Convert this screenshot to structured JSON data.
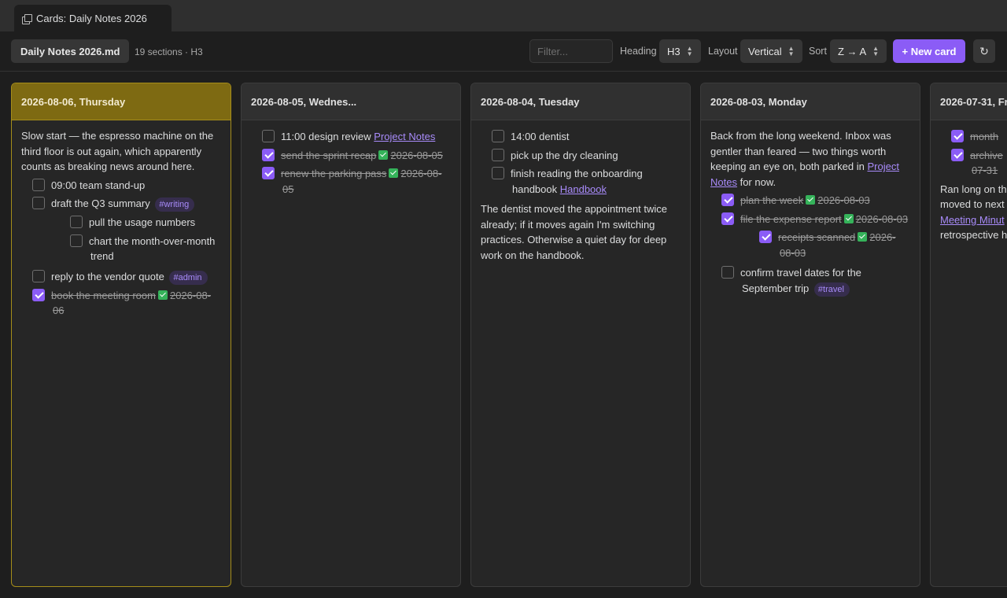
{
  "tab": {
    "title": "Cards: Daily Notes 2026",
    "icon": "cards-icon"
  },
  "toolbar": {
    "file": "Daily Notes 2026.md",
    "meta": "19 sections · H3",
    "filter_placeholder": "Filter...",
    "heading_label": "Heading",
    "heading_value": "H3",
    "layout_label": "Layout",
    "layout_value": "Vertical",
    "sort_label": "Sort",
    "sort_value": "Z → A",
    "new_card": "+ New card",
    "refresh": "↻"
  },
  "colors": {
    "accent": "#8b5cf6",
    "active_card": "#7e6a12",
    "done_check": "#35b35a",
    "tag_text": "#a88bfa"
  },
  "cards": [
    {
      "title": "2026-08-06, Thursday",
      "para": "Slow start — the espresso machine on the third floor is out again, which apparently counts as breaking news around here.",
      "tasks": [
        {
          "text": "09:00 team stand-up"
        },
        {
          "text": "draft the Q3 summary",
          "tag": "#writing"
        },
        {
          "text": "pull the usage numbers"
        },
        {
          "text": "chart the month-over-month trend"
        },
        {
          "text": "reply to the vendor quote",
          "tag": "#admin"
        },
        {
          "text": "book the meeting room",
          "date": "2026-08-06"
        }
      ]
    },
    {
      "title": "2026-08-05, Wednes...",
      "tasks": [
        {
          "text": "11:00 design review",
          "link": "Project Notes"
        },
        {
          "text": "send the sprint recap",
          "date": "2026-08-05"
        },
        {
          "text": "renew the parking pass",
          "date": "2026-08-05"
        }
      ]
    },
    {
      "title": "2026-08-04, Tuesday",
      "tasks": [
        {
          "text": "14:00 dentist"
        },
        {
          "text": "pick up the dry cleaning"
        },
        {
          "text": "finish reading the onboarding handbook",
          "link": "Handbook"
        }
      ],
      "para": "The dentist moved the appointment twice already; if it moves again I'm switching practices. Otherwise a quiet day for deep work on the handbook."
    },
    {
      "title": "2026-08-03, Monday",
      "para_a": "Back from the long weekend. Inbox was gentler than feared — two things worth keeping an eye on, both parked in",
      "para_link": "Project Notes",
      "para_b": "for now.",
      "tasks": [
        {
          "text": "plan the week",
          "date": "2026-08-03"
        },
        {
          "text": "file the expense report",
          "date": "2026-08-03"
        },
        {
          "text": "receipts scanned",
          "date": "2026-08-03"
        },
        {
          "text": "confirm travel dates for the September trip",
          "tag": "#travel"
        }
      ]
    },
    {
      "title": "2026-07-31, Fr",
      "tasks": [
        {
          "text": "month"
        },
        {
          "text": "archive"
        },
        {
          "text": "07-31"
        }
      ],
      "para_a": "Ran long on th",
      "para_b": "moved to next",
      "para_link": "Meeting Minut",
      "para_c": "retrospective h"
    }
  ]
}
